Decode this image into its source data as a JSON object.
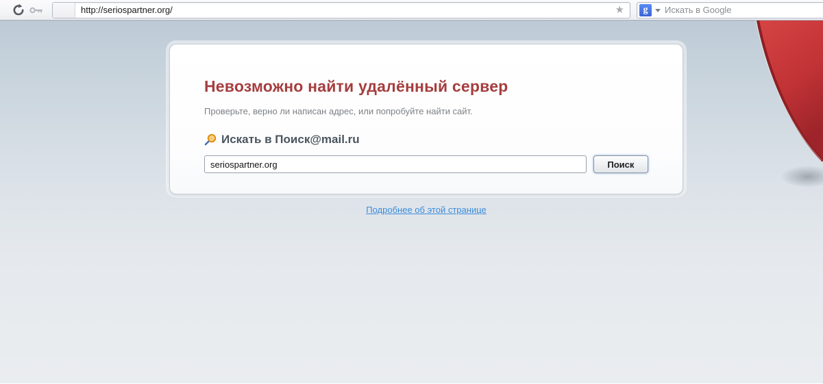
{
  "toolbar": {
    "url": "http://seriospartner.org/",
    "search_placeholder": "Искать в Google",
    "google_glyph": "g"
  },
  "page": {
    "error_card": {
      "title": "Невозможно найти удалённый сервер",
      "subtitle": "Проверьте, верно ли написан адрес, или попробуйте найти сайт.",
      "search_heading": "Искать в Поиск@mail.ru",
      "search_input_value": "seriospartner.org",
      "search_button_label": "Поиск"
    },
    "more_link": "Подробнее об этой странице"
  },
  "colors": {
    "title_red": "#a53d3e",
    "link_blue": "#3a8bdb",
    "decoration_red_top": "#d64444",
    "decoration_red_bottom": "#9c242a",
    "google_blue": "#3a63d8"
  }
}
